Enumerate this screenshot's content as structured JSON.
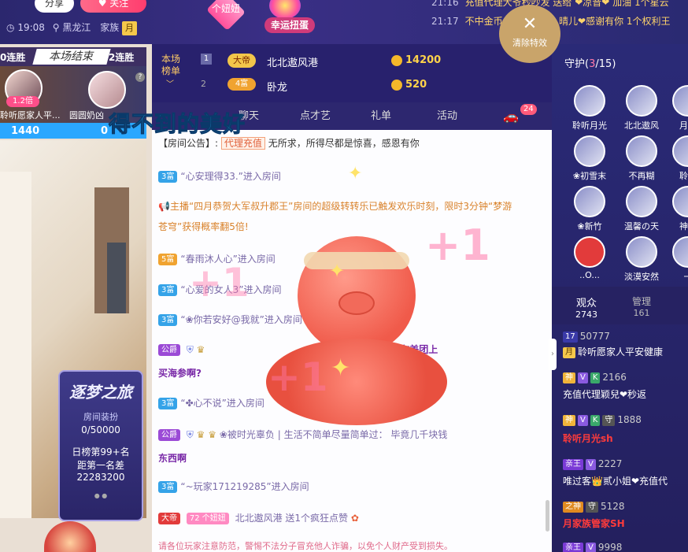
{
  "header": {
    "share_label": "分享",
    "follow_label": "关注",
    "time": "19:08",
    "location": "黑龙江",
    "family_label": "家族",
    "family_tag": "月",
    "girl_badge": "个妞妞",
    "lucky_egg_label": "幸运扭蛋",
    "clear_effects_label": "清除特效"
  },
  "ticker": [
    {
      "time": "21:16",
      "text": "充值代理大爷秒吵发 送给 ❤凉音❤ 加油 1个星云"
    },
    {
      "time": "21:17",
      "text": "不中金币 个仔儿 送给 晴儿❤感谢有你 1个权利王"
    }
  ],
  "pk": {
    "left_streak": "0连胜",
    "title": "本场结束",
    "right_streak": "2连胜",
    "left_multiplier": "1.2倍",
    "left_name": "聆听愿家人平...",
    "right_name": "圆圆奶凶",
    "left_score": "1440",
    "right_score": "0",
    "help": "?"
  },
  "poster": {
    "title": "逐梦之旅",
    "label": "房间装扮",
    "progress": "0/50000",
    "rank": "日榜第99+名",
    "gap_label": "距第一名差",
    "gap": "22283200"
  },
  "rank_board": {
    "label": "本场榜单",
    "rows": [
      {
        "num": "1",
        "badge": "大帝",
        "name": "北北遨风港",
        "coins": "14200"
      },
      {
        "num": "2",
        "badge": "4富",
        "name": "卧龙",
        "coins": "520"
      }
    ]
  },
  "banner_text": "得不到的美好",
  "tabs": [
    {
      "label": "聊天"
    },
    {
      "label": "点才艺"
    },
    {
      "label": "礼单"
    },
    {
      "label": "活动"
    }
  ],
  "tab_car_count": "24",
  "chat": {
    "announcement_prefix": "【房间公告】:",
    "announcement_tag": "代理充值",
    "announcement_text": "无所求，所得尽都是惊喜，感恩有你",
    "messages": [
      {
        "level": "3富",
        "text": "“心安理得33.”进入房间"
      },
      {
        "level": "",
        "text": "主播“四月恭贺大军叔升郡王”房间的超级转转乐已触发欢乐时刻，限时3分钟“梦游"
      },
      {
        "level": "",
        "text": "苍穹”获得概率翻5倍!"
      },
      {
        "level": "5富",
        "text": "“春雨沐人心”进入房间"
      },
      {
        "level": "3富",
        "text": "“心爱的女人3”进入房间"
      },
      {
        "level": "3富",
        "text": "“❀你若安好@我就”进入房间"
      },
      {
        "level": "公爵",
        "text": "谁会在美团上"
      },
      {
        "level": "",
        "text": "买海参啊?"
      },
      {
        "level": "3富",
        "text": "“✤心不说”进入房间"
      },
      {
        "level": "公爵",
        "text": "❀被时光辜负 | 生活不简单尽量简单过： 毕竟几千块钱"
      },
      {
        "level": "",
        "text": "东西啊"
      },
      {
        "level": "3富",
        "text": "“~玩家171219285”进入房间"
      },
      {
        "level": "大帝",
        "text": "北北遨风港 送1个疯狂点赞"
      }
    ],
    "girl_badge": "个妞妞",
    "girl_level": "72",
    "footer_notice": "请各位玩家注意防范，警惕不法分子冒充他人诈骗，以免个人财产受到损失。"
  },
  "guard": {
    "title": "守护",
    "count": "3",
    "total": "15",
    "members": [
      "聆听月光",
      "北北遨风",
      "月家",
      "❀初雪末",
      "不再糊",
      "聆听",
      "❀新竹",
      "温馨の天",
      "神秘",
      "..O...",
      "淡漠安然",
      "一"
    ]
  },
  "audience": {
    "tab_audience": "观众",
    "audience_count": "2743",
    "tab_admin": "管理",
    "admin_count": "161",
    "list": [
      {
        "id": "50777",
        "name": "聆听愿家人平安健康",
        "badges": [
          "17",
          "月"
        ]
      },
      {
        "id": "2166",
        "name": "充值代理颖兒❤秒返",
        "badges": [
          "神",
          "V",
          "K"
        ]
      },
      {
        "id": "1888",
        "name": "聆听月光sh",
        "badges": [
          "神",
          "V",
          "K",
          "守"
        ]
      },
      {
        "id": "2227",
        "name": "唯过客👑贰小姐❤充值代",
        "badges": [
          "亲王",
          "V"
        ]
      },
      {
        "id": "5128",
        "name": "月家族管家SH",
        "badges": [
          "之神",
          "守"
        ]
      },
      {
        "id": "9998",
        "name": "",
        "badges": [
          "亲王",
          "V"
        ]
      }
    ]
  },
  "overlay_text": "+1",
  "colors": {
    "accent_purple": "#2d276f",
    "chat_bg": "#fdfdff",
    "gold": "#f0b43a",
    "name_purple": "#7a2aa8",
    "red": "#e23b3b"
  }
}
